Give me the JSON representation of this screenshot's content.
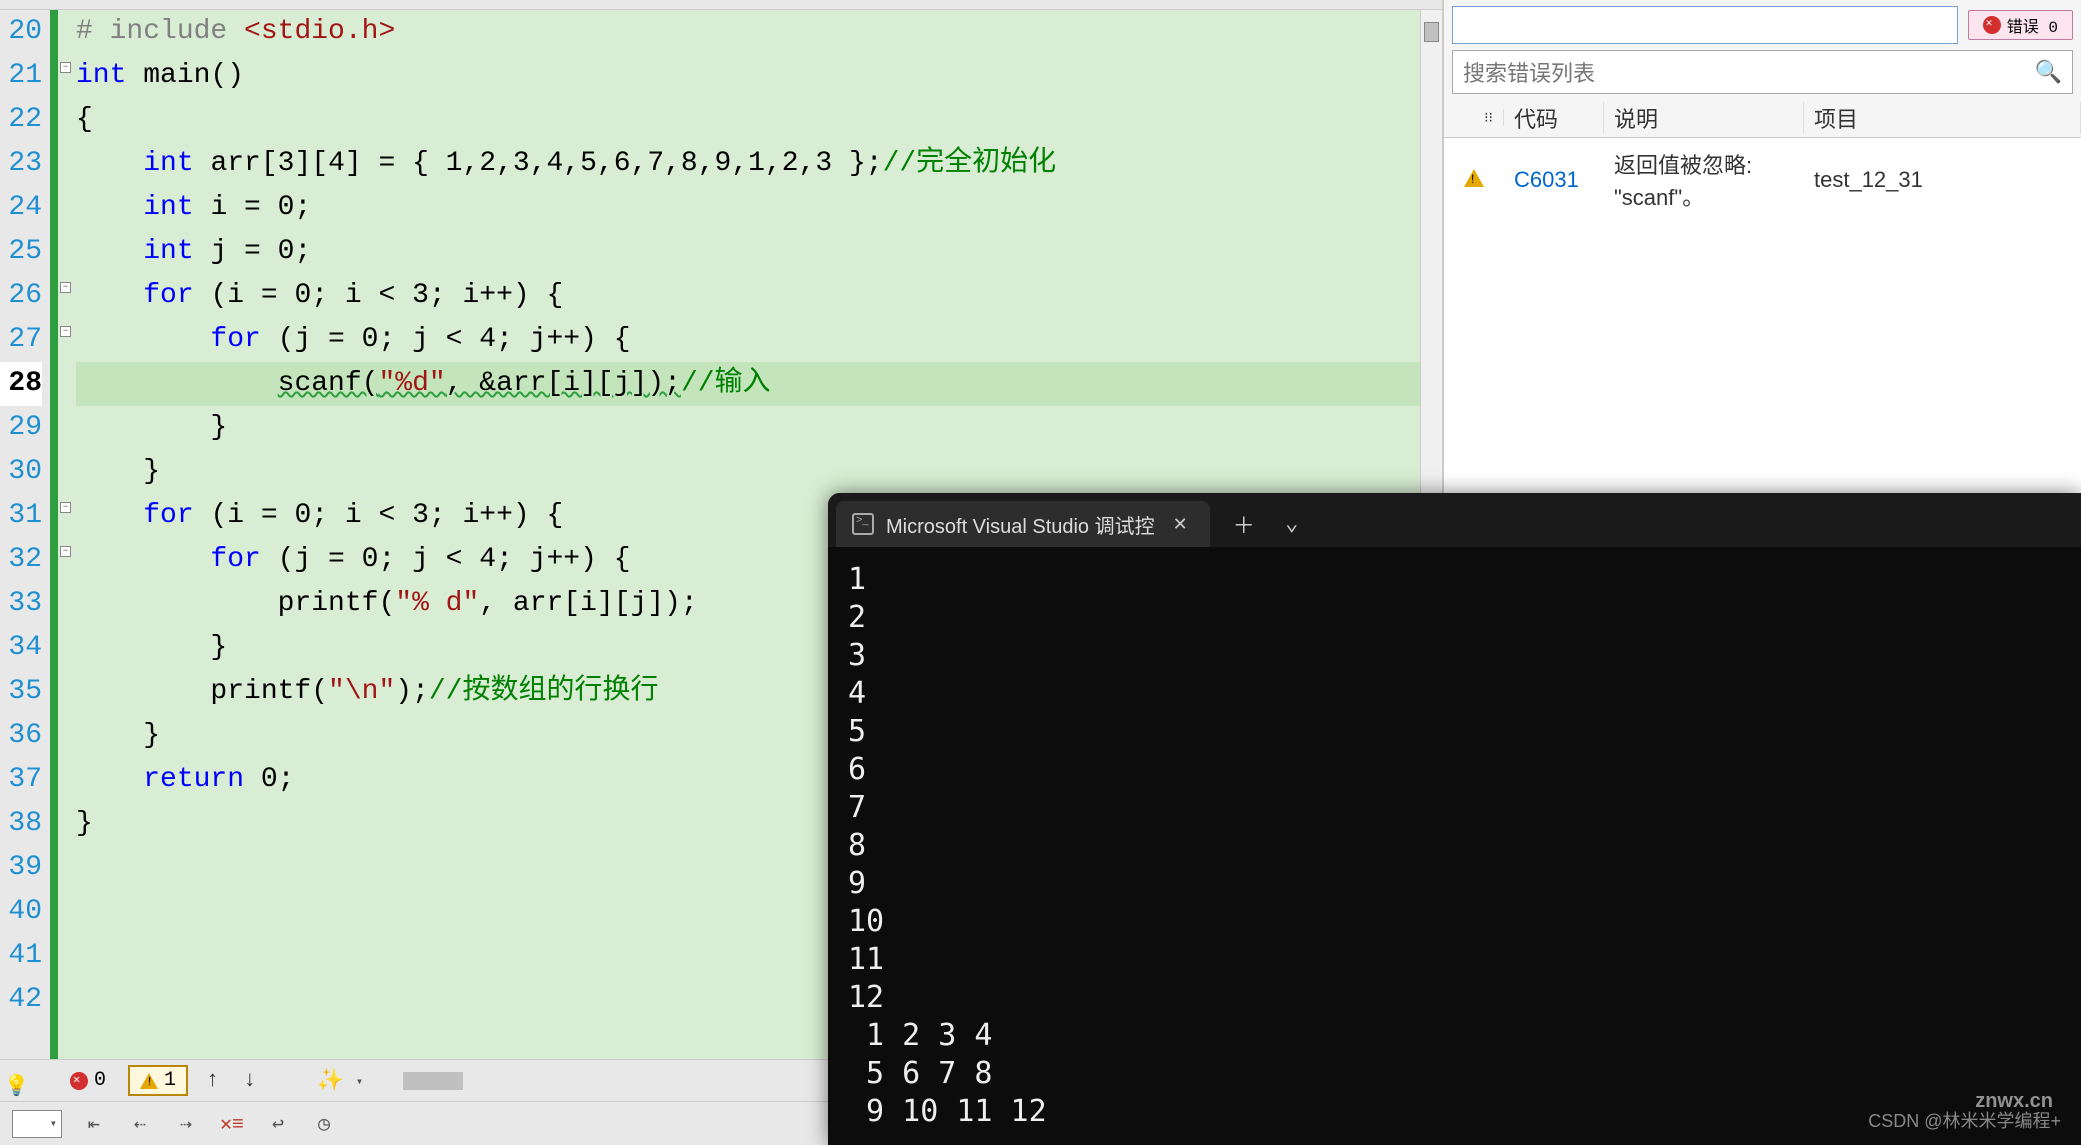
{
  "lineNumbers": [
    "20",
    "21",
    "22",
    "23",
    "24",
    "25",
    "26",
    "27",
    "28",
    "29",
    "30",
    "31",
    "32",
    "33",
    "34",
    "35",
    "36",
    "37",
    "38",
    "39",
    "40",
    "41",
    "42"
  ],
  "currentLine": "28",
  "code": {
    "l20": {
      "pre": "# include ",
      "inc": "<stdio.h>"
    },
    "l21": {
      "t1": "int",
      "t2": " main()"
    },
    "l22": "{",
    "l23": {
      "ind": "    ",
      "kw": "int",
      "rest": " arr[3][4] = { 1,2,3,4,5,6,7,8,9,1,2,3 };",
      "cmt": "//完全初始化"
    },
    "l24": {
      "ind": "    ",
      "kw": "int",
      "rest": " i = 0;"
    },
    "l25": {
      "ind": "    ",
      "kw": "int",
      "rest": " j = 0;"
    },
    "l26": {
      "ind": "    ",
      "kw": "for",
      "rest": " (i = 0; i < 3; i++) {"
    },
    "l27": {
      "ind": "        ",
      "kw": "for",
      "rest": " (j = 0; j < 4; j++) {"
    },
    "l28": {
      "ind": "            ",
      "fn": "scanf(",
      "str": "\"%d\"",
      "rest": ", &arr[i][j]);",
      "cmt": "//输入"
    },
    "l29": "        }",
    "l30": "    }",
    "l31": {
      "ind": "    ",
      "kw": "for",
      "rest": " (i = 0; i < 3; i++) {"
    },
    "l32": {
      "ind": "        ",
      "kw": "for",
      "rest": " (j = 0; j < 4; j++) {"
    },
    "l33": {
      "ind": "            ",
      "fn": "printf(",
      "str": "\"% d\"",
      "rest": ", arr[i][j]);"
    },
    "l34": "        }",
    "l35": {
      "ind": "        ",
      "fn": "printf(",
      "str": "\"\\n\"",
      "rest": ");",
      "cmt": "//按数组的行换行"
    },
    "l36": "    }",
    "l37": {
      "ind": "    ",
      "kw": "return",
      "rest": " 0;"
    },
    "l38": "}"
  },
  "statusBar": {
    "errors": "0",
    "warnings": "1"
  },
  "rightPanel": {
    "errPill": "错误 0",
    "searchPlaceholder": "搜索错误列表",
    "headers": {
      "code": "代码",
      "desc": "说明",
      "proj": "项目"
    },
    "row": {
      "code": "C6031",
      "desc": "返回值被忽略: \"scanf\"。",
      "proj": "test_12_31"
    }
  },
  "terminal": {
    "tabTitle": "Microsoft Visual Studio 调试控",
    "output": "1\n2\n3\n4\n5\n6\n7\n8\n9\n10\n11\n12\n 1 2 3 4\n 5 6 7 8\n 9 10 11 12"
  },
  "watermark": "CSDN @林米米学编程+",
  "watermark2": "znwx.cn"
}
